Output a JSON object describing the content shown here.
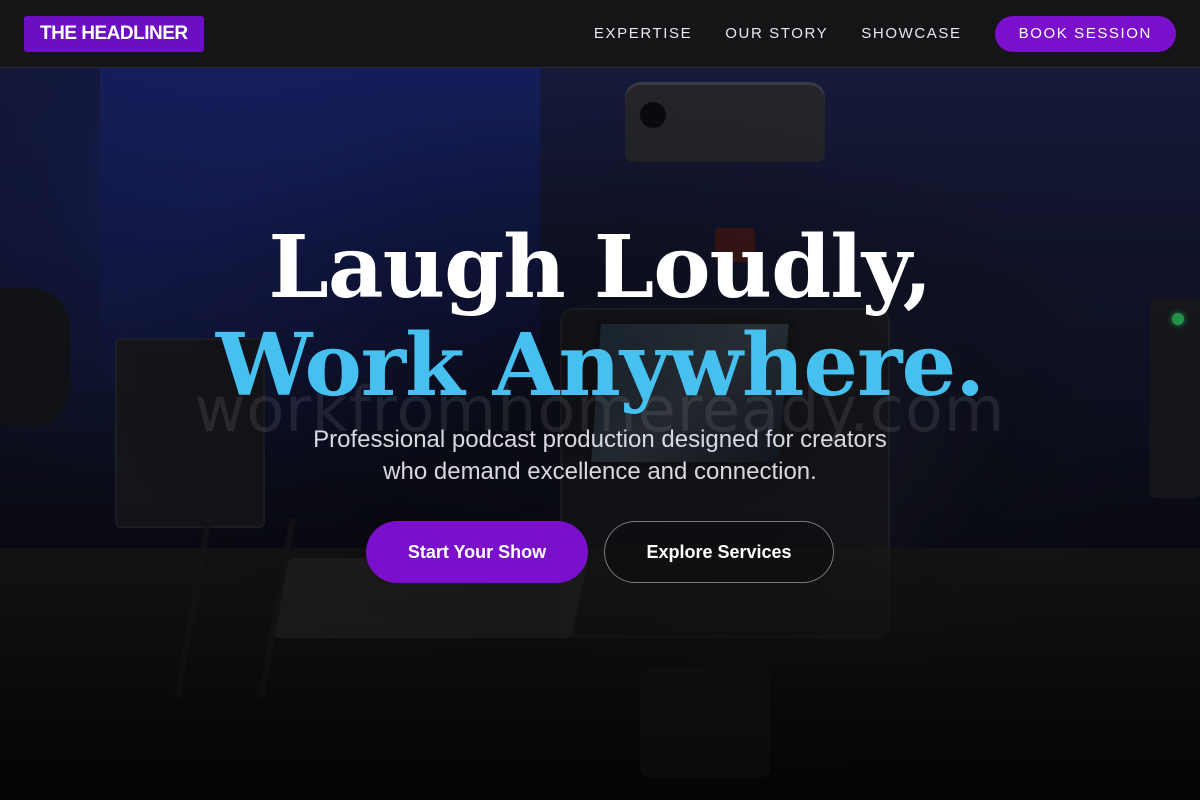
{
  "nav": {
    "logo": "THE HEADLINER",
    "links": [
      "EXPERTISE",
      "OUR STORY",
      "SHOWCASE"
    ],
    "cta": "BOOK SESSION"
  },
  "hero": {
    "headline_line1": "Laugh Loudly,",
    "headline_line2": "Work Anywhere.",
    "subtext_line1": "Professional podcast production designed for creators",
    "subtext_line2": "who demand excellence and connection.",
    "primary_button": "Start Your Show",
    "secondary_button": "Explore Services",
    "watermark": "workfromhomeready.com"
  },
  "colors": {
    "brand_purple": "#7a10cc",
    "accent_cyan": "#45c0ef",
    "nav_bg": "#151517"
  }
}
